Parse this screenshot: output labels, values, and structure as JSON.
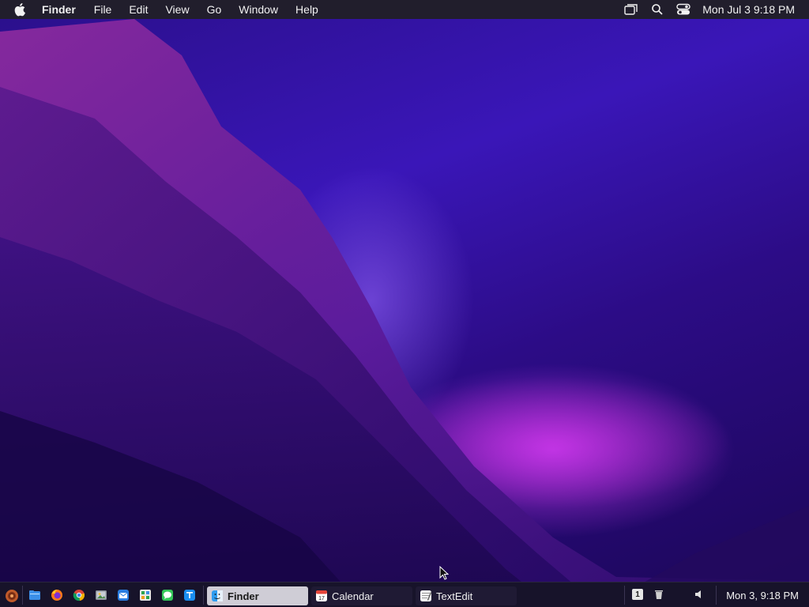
{
  "menubar": {
    "apple_icon": "apple-logo-icon",
    "app_name": "Finder",
    "menus": [
      "File",
      "Edit",
      "View",
      "Go",
      "Window",
      "Help"
    ],
    "right_icons": [
      "screen-mirroring-icon",
      "search-icon",
      "control-center-icon"
    ],
    "clock": "Mon Jul 3  9:18 PM"
  },
  "taskbar": {
    "launcher_icon": "app-launcher-icon",
    "quick_launch": [
      "files-icon",
      "firefox-icon",
      "chrome-icon",
      "image-viewer-icon",
      "mail-icon",
      "spreadsheet-icon",
      "messages-icon",
      "text-editor-icon"
    ],
    "tasks": [
      {
        "label": "Finder",
        "icon": "finder-icon",
        "active": true
      },
      {
        "label": "Calendar",
        "icon": "calendar-icon",
        "active": false
      },
      {
        "label": "TextEdit",
        "icon": "textedit-icon",
        "active": false
      }
    ],
    "workspace_number": "1",
    "tray_icons": [
      "trash-icon",
      "volume-icon"
    ],
    "clock": "Mon 3, 9:18 PM"
  },
  "colors": {
    "menubar_bg": "#211e2c",
    "taskbar_bg": "#17132a",
    "active_task_bg": "#cfcdd6",
    "wallpaper_primary": "#3a16b8",
    "wallpaper_accent": "#c22ad0"
  }
}
